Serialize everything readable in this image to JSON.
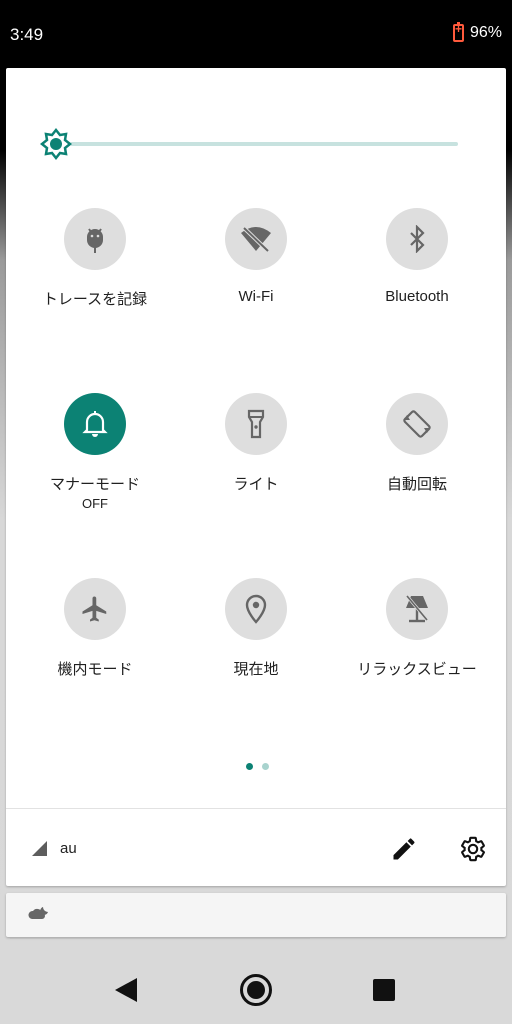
{
  "status_bar": {
    "time": "3:49",
    "battery": "96%"
  },
  "quick_settings": {
    "tiles": [
      {
        "label": "トレースを記録",
        "icon": "android-icon",
        "active": false
      },
      {
        "label": "Wi-Fi",
        "icon": "wifi-off-icon",
        "active": false
      },
      {
        "label": "Bluetooth",
        "icon": "bluetooth-icon",
        "active": false
      },
      {
        "label": "マナーモード",
        "sub": "OFF",
        "icon": "bell-icon",
        "active": true
      },
      {
        "label": "ライト",
        "icon": "flashlight-icon",
        "active": false
      },
      {
        "label": "自動回転",
        "icon": "auto-rotate-icon",
        "active": false
      },
      {
        "label": "機内モード",
        "icon": "airplane-icon",
        "active": false
      },
      {
        "label": "現在地",
        "icon": "location-icon",
        "active": false
      },
      {
        "label": "リラックスビュー",
        "icon": "relax-view-icon",
        "active": false
      }
    ],
    "page_count": 2,
    "current_page": 1,
    "carrier": "au",
    "accent_color": "#0c8274"
  }
}
